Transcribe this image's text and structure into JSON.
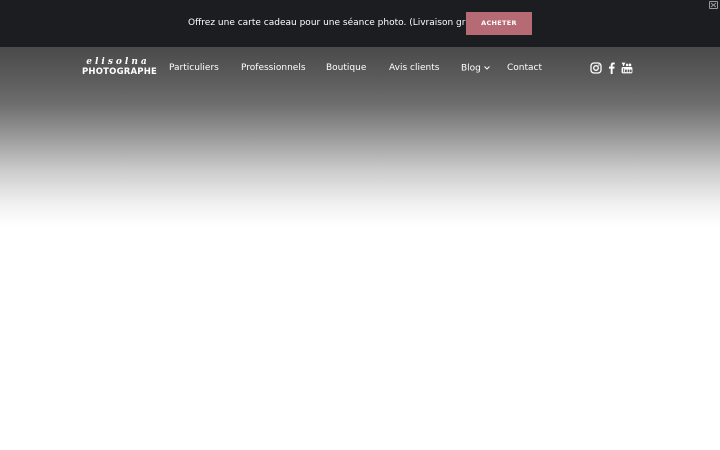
{
  "promo": {
    "text": "Offrez une carte cadeau pour une séance photo. (Livraison gratuite)",
    "button_label": "ACHETER",
    "button_color": "#b66a74",
    "background_color": "#1c1d21"
  },
  "header": {
    "logo": {
      "script": "elisolna",
      "word": "PHOTOGRAPHE"
    },
    "nav": {
      "particuliers": "Particuliers",
      "professionnels": "Professionnels",
      "boutique": "Boutique",
      "avis": "Avis clients",
      "blog": "Blog",
      "contact": "Contact"
    },
    "social_icons": [
      "instagram-icon",
      "facebook-icon",
      "youtube-icon"
    ]
  }
}
